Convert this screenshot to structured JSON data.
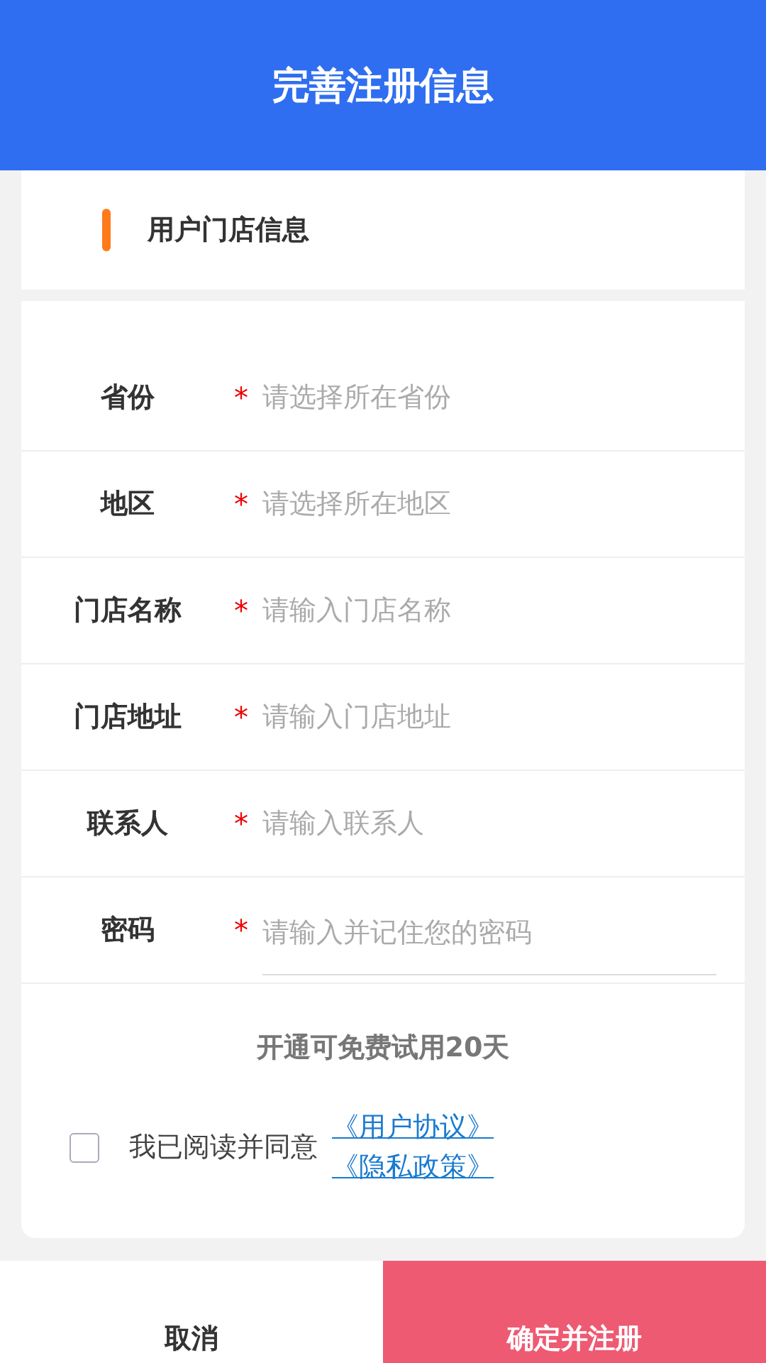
{
  "header": {
    "title": "完善注册信息"
  },
  "section": {
    "title": "用户门店信息"
  },
  "fields": [
    {
      "label": "省份",
      "required": true,
      "placeholder": "请选择所在省份",
      "kind": "select"
    },
    {
      "label": "地区",
      "required": true,
      "placeholder": "请选择所在地区",
      "kind": "select"
    },
    {
      "label": "门店名称",
      "required": true,
      "placeholder": "请输入门店名称",
      "kind": "text"
    },
    {
      "label": "门店地址",
      "required": true,
      "placeholder": "请输入门店地址",
      "kind": "text"
    },
    {
      "label": "联系人",
      "required": true,
      "placeholder": "请输入联系人",
      "kind": "text"
    },
    {
      "label": "密码",
      "required": true,
      "placeholder": "请输入并记住您的密码",
      "kind": "password"
    }
  ],
  "required_mark": "*",
  "trial_notice": "开通可免费试用20天",
  "agreement": {
    "checked": false,
    "text": "我已阅读并同意",
    "links": [
      "《用户协议》",
      "《隐私政策》"
    ]
  },
  "buttons": {
    "cancel": "取消",
    "confirm": "确定并注册"
  }
}
